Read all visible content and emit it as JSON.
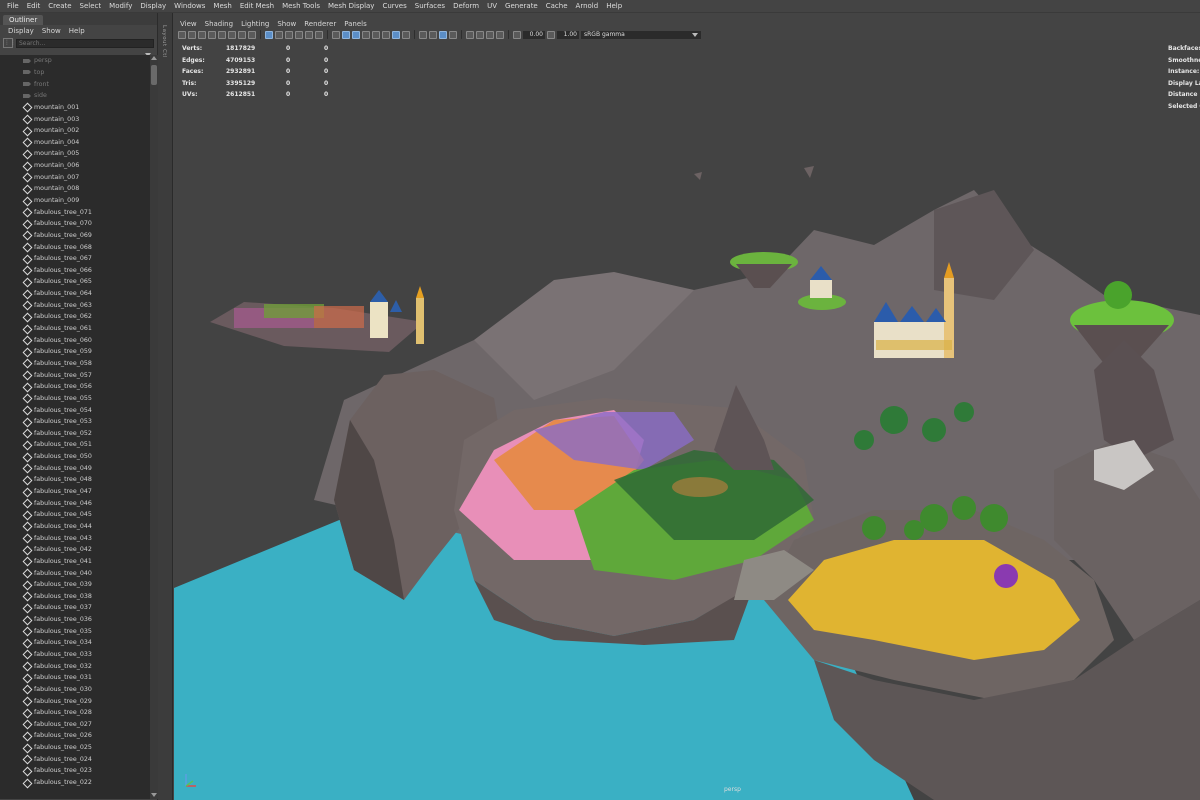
{
  "menubar": [
    "File",
    "Edit",
    "Create",
    "Select",
    "Modify",
    "Display",
    "Windows",
    "Mesh",
    "Edit Mesh",
    "Mesh Tools",
    "Mesh Display",
    "Curves",
    "Surfaces",
    "Deform",
    "UV",
    "Generate",
    "Cache",
    "Arnold",
    "Help"
  ],
  "outliner": {
    "tab": "Outliner",
    "menu": [
      "Display",
      "Show",
      "Help"
    ],
    "search_placeholder": "Search...",
    "cameras": [
      "persp",
      "top",
      "front",
      "side"
    ],
    "items": [
      "mountain_001",
      "mountain_003",
      "mountain_002",
      "mountain_004",
      "mountain_005",
      "mountain_006",
      "mountain_007",
      "mountain_008",
      "mountain_009",
      "fabulous_tree_071",
      "fabulous_tree_070",
      "fabulous_tree_069",
      "fabulous_tree_068",
      "fabulous_tree_067",
      "fabulous_tree_066",
      "fabulous_tree_065",
      "fabulous_tree_064",
      "fabulous_tree_063",
      "fabulous_tree_062",
      "fabulous_tree_061",
      "fabulous_tree_060",
      "fabulous_tree_059",
      "fabulous_tree_058",
      "fabulous_tree_057",
      "fabulous_tree_056",
      "fabulous_tree_055",
      "fabulous_tree_054",
      "fabulous_tree_053",
      "fabulous_tree_052",
      "fabulous_tree_051",
      "fabulous_tree_050",
      "fabulous_tree_049",
      "fabulous_tree_048",
      "fabulous_tree_047",
      "fabulous_tree_046",
      "fabulous_tree_045",
      "fabulous_tree_044",
      "fabulous_tree_043",
      "fabulous_tree_042",
      "fabulous_tree_041",
      "fabulous_tree_040",
      "fabulous_tree_039",
      "fabulous_tree_038",
      "fabulous_tree_037",
      "fabulous_tree_036",
      "fabulous_tree_035",
      "fabulous_tree_034",
      "fabulous_tree_033",
      "fabulous_tree_032",
      "fabulous_tree_031",
      "fabulous_tree_030",
      "fabulous_tree_029",
      "fabulous_tree_028",
      "fabulous_tree_027",
      "fabulous_tree_026",
      "fabulous_tree_025",
      "fabulous_tree_024",
      "fabulous_tree_023",
      "fabulous_tree_022"
    ]
  },
  "sidestrip_label": "Layout Ctl",
  "viewport": {
    "menu": [
      "View",
      "Shading",
      "Lighting",
      "Show",
      "Renderer",
      "Panels"
    ],
    "toolbar": {
      "value1": "0.00",
      "value2": "1.00",
      "colorspace": "sRGB gamma"
    },
    "hud_stats": [
      {
        "label": "Verts:",
        "v1": "1817829",
        "v2": "0",
        "v3": "0"
      },
      {
        "label": "Edges:",
        "v1": "4709153",
        "v2": "0",
        "v3": "0"
      },
      {
        "label": "Faces:",
        "v1": "2932891",
        "v2": "0",
        "v3": "0"
      },
      {
        "label": "Tris:",
        "v1": "3395129",
        "v2": "0",
        "v3": "0"
      },
      {
        "label": "UVs:",
        "v1": "2612851",
        "v2": "0",
        "v3": "0"
      }
    ],
    "hud_right": [
      "Backfaces:",
      "Smoothnes",
      "Instance:",
      "Display Lay",
      "Distance Fr",
      "Selected O"
    ],
    "camera": "persp",
    "colors": {
      "water": "#3ab0c4",
      "rock": "#6e6563",
      "rock_dark": "#4f4746",
      "grass": "#5fa83a",
      "sand": "#e0b431",
      "pink": "#e88fb8",
      "bg": "#434343"
    }
  }
}
